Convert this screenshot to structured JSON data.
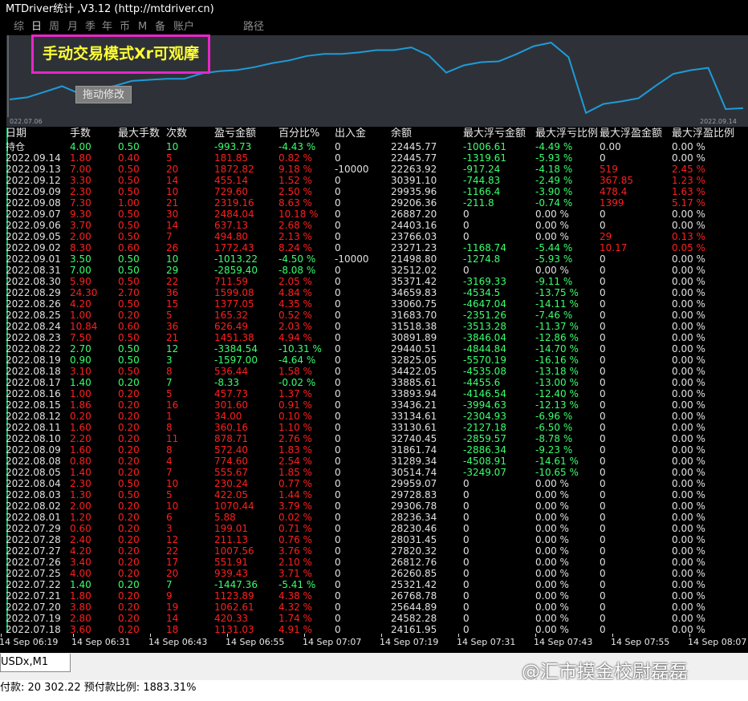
{
  "window": {
    "title": "MTDriver统计 ,V3.12 (http://mtdriver.cn)"
  },
  "tabs": [
    "综",
    "日",
    "周",
    "月",
    "季",
    "年",
    "币",
    "M",
    "备",
    "账户",
    "路径"
  ],
  "active_tab_index": 1,
  "chart": {
    "mode_label": "手动交易模式Xr可观摩",
    "drag_button": "拖动修改",
    "start_date": "022.07.06",
    "end_date": "2022.09.14",
    "line_color": "#1e9bd8",
    "balance_series": [
      24161.95,
      24582.28,
      25644.89,
      26768.78,
      25321.42,
      26260.85,
      26812.76,
      27820.32,
      28031.45,
      28230.46,
      28236.34,
      29306.78,
      29728.83,
      29959.07,
      30514.74,
      31289.34,
      31861.74,
      32740.45,
      33130.61,
      33134.61,
      33436.21,
      33893.94,
      33885.61,
      34422.05,
      32825.05,
      29440.51,
      30891.89,
      31518.38,
      31683.7,
      33060.75,
      34659.83,
      35371.42,
      32512.02,
      21498.8,
      23271.23,
      23766.03,
      24403.16,
      26887.2,
      29206.36,
      29935.96,
      30391.1,
      22263.92,
      22445.77
    ]
  },
  "table": {
    "headers": [
      "日期",
      "手数",
      "最大手数",
      "次数",
      "盈亏金额",
      "百分比%",
      "出入金",
      "余额",
      "最大浮亏金额",
      "最大浮亏比例",
      "最大浮盈金额",
      "最大浮盈比例"
    ],
    "rows": [
      [
        "持仓",
        "4.00",
        "0.50",
        "10",
        "-993.73",
        "-4.43 %",
        "0",
        "22445.77",
        "-1006.61",
        "-4.49 %",
        "0.00",
        "0.00 %"
      ],
      [
        "2022.09.14",
        "1.80",
        "0.40",
        "5",
        "181.85",
        "0.82 %",
        "0",
        "22445.77",
        "-1319.61",
        "-5.93 %",
        "0",
        "0.00 %"
      ],
      [
        "2022.09.13",
        "7.00",
        "0.50",
        "20",
        "1872.82",
        "9.18 %",
        "-10000",
        "22263.92",
        "-917.24",
        "-4.18 %",
        "519",
        "2.45 %"
      ],
      [
        "2022.09.12",
        "3.30",
        "0.50",
        "14",
        "455.14",
        "1.52 %",
        "0",
        "30391.10",
        "-744.83",
        "-2.49 %",
        "367.85",
        "1.23 %"
      ],
      [
        "2022.09.09",
        "2.30",
        "0.50",
        "10",
        "729.60",
        "2.50 %",
        "0",
        "29935.96",
        "-1166.4",
        "-3.90 %",
        "478.4",
        "1.63 %"
      ],
      [
        "2022.09.08",
        "7.30",
        "1.00",
        "21",
        "2319.16",
        "8.63 %",
        "0",
        "29206.36",
        "-211.8",
        "-0.74 %",
        "1399",
        "5.17 %"
      ],
      [
        "2022.09.07",
        "9.30",
        "0.50",
        "30",
        "2484.04",
        "10.18 %",
        "0",
        "26887.20",
        "0",
        "0.00 %",
        "0",
        "0.00 %"
      ],
      [
        "2022.09.06",
        "3.70",
        "0.50",
        "14",
        "637.13",
        "2.68 %",
        "0",
        "24403.16",
        "0",
        "0.00 %",
        "0",
        "0.00 %"
      ],
      [
        "2022.09.05",
        "2.00",
        "0.50",
        "7",
        "494.80",
        "2.13 %",
        "0",
        "23766.03",
        "0",
        "0.00 %",
        "29",
        "0.13 %"
      ],
      [
        "2022.09.02",
        "8.30",
        "0.60",
        "26",
        "1772.43",
        "8.24 %",
        "0",
        "23271.23",
        "-1168.74",
        "-5.44 %",
        "10.17",
        "0.05 %"
      ],
      [
        "2022.09.01",
        "3.50",
        "0.50",
        "10",
        "-1013.22",
        "-4.50 %",
        "-10000",
        "21498.80",
        "-1274.8",
        "-5.93 %",
        "0",
        "0.00 %"
      ],
      [
        "2022.08.31",
        "7.00",
        "0.50",
        "29",
        "-2859.40",
        "-8.08 %",
        "0",
        "32512.02",
        "0",
        "0.00 %",
        "0",
        "0.00 %"
      ],
      [
        "2022.08.30",
        "5.90",
        "0.50",
        "22",
        "711.59",
        "2.05 %",
        "0",
        "35371.42",
        "-3169.33",
        "-9.11 %",
        "0",
        "0.00 %"
      ],
      [
        "2022.08.29",
        "24.30",
        "2.70",
        "36",
        "1599.08",
        "4.84 %",
        "0",
        "34659.83",
        "-4534.5",
        "-13.75 %",
        "0",
        "0.00 %"
      ],
      [
        "2022.08.26",
        "4.20",
        "0.50",
        "15",
        "1377.05",
        "4.35 %",
        "0",
        "33060.75",
        "-4647.04",
        "-14.11 %",
        "0",
        "0.00 %"
      ],
      [
        "2022.08.25",
        "1.00",
        "0.20",
        "5",
        "165.32",
        "0.52 %",
        "0",
        "31683.70",
        "-2351.26",
        "-7.46 %",
        "0",
        "0.00 %"
      ],
      [
        "2022.08.24",
        "10.84",
        "0.60",
        "36",
        "626.49",
        "2.03 %",
        "0",
        "31518.38",
        "-3513.28",
        "-11.37 %",
        "0",
        "0.00 %"
      ],
      [
        "2022.08.23",
        "7.50",
        "0.50",
        "21",
        "1451.38",
        "4.94 %",
        "0",
        "30891.89",
        "-3846.04",
        "-12.86 %",
        "0",
        "0.00 %"
      ],
      [
        "2022.08.22",
        "2.70",
        "0.50",
        "12",
        "-3384.54",
        "-10.31 %",
        "0",
        "29440.51",
        "-4844.84",
        "-14.70 %",
        "0",
        "0.00 %"
      ],
      [
        "2022.08.19",
        "0.90",
        "0.50",
        "3",
        "-1597.00",
        "-4.64 %",
        "0",
        "32825.05",
        "-5570.19",
        "-16.16 %",
        "0",
        "0.00 %"
      ],
      [
        "2022.08.18",
        "3.10",
        "0.50",
        "8",
        "536.44",
        "1.58 %",
        "0",
        "34422.05",
        "-4535.08",
        "-13.18 %",
        "0",
        "0.00 %"
      ],
      [
        "2022.08.17",
        "1.40",
        "0.20",
        "7",
        "-8.33",
        "-0.02 %",
        "0",
        "33885.61",
        "-4455.6",
        "-13.00 %",
        "0",
        "0.00 %"
      ],
      [
        "2022.08.16",
        "1.00",
        "0.20",
        "5",
        "457.73",
        "1.37 %",
        "0",
        "33893.94",
        "-4146.54",
        "-12.40 %",
        "0",
        "0.00 %"
      ],
      [
        "2022.08.15",
        "1.86",
        "0.20",
        "16",
        "301.60",
        "0.91 %",
        "0",
        "33436.21",
        "-3994.63",
        "-12.13 %",
        "0",
        "0.00 %"
      ],
      [
        "2022.08.12",
        "0.20",
        "0.20",
        "1",
        "34.00",
        "0.10 %",
        "0",
        "33134.61",
        "-2304.93",
        "-6.96 %",
        "0",
        "0.00 %"
      ],
      [
        "2022.08.11",
        "1.60",
        "0.20",
        "8",
        "360.16",
        "1.10 %",
        "0",
        "33130.61",
        "-2127.18",
        "-6.50 %",
        "0",
        "0.00 %"
      ],
      [
        "2022.08.10",
        "2.20",
        "0.20",
        "11",
        "878.71",
        "2.76 %",
        "0",
        "32740.45",
        "-2859.57",
        "-8.78 %",
        "0",
        "0.00 %"
      ],
      [
        "2022.08.09",
        "1.60",
        "0.20",
        "8",
        "572.40",
        "1.83 %",
        "0",
        "31861.74",
        "-2886.34",
        "-9.23 %",
        "0",
        "0.00 %"
      ],
      [
        "2022.08.08",
        "0.80",
        "0.20",
        "4",
        "774.60",
        "2.54 %",
        "0",
        "31289.34",
        "-4508.91",
        "-14.61 %",
        "0",
        "0.00 %"
      ],
      [
        "2022.08.05",
        "1.40",
        "0.20",
        "7",
        "555.67",
        "1.85 %",
        "0",
        "30514.74",
        "-3249.07",
        "-10.65 %",
        "0",
        "0.00 %"
      ],
      [
        "2022.08.04",
        "2.30",
        "0.50",
        "10",
        "230.24",
        "0.77 %",
        "0",
        "29959.07",
        "0",
        "0.00 %",
        "0",
        "0.00 %"
      ],
      [
        "2022.08.03",
        "1.30",
        "0.50",
        "5",
        "422.05",
        "1.44 %",
        "0",
        "29728.83",
        "0",
        "0.00 %",
        "0",
        "0.00 %"
      ],
      [
        "2022.08.02",
        "2.00",
        "0.20",
        "10",
        "1070.44",
        "3.79 %",
        "0",
        "29306.78",
        "0",
        "0.00 %",
        "0",
        "0.00 %"
      ],
      [
        "2022.08.01",
        "1.20",
        "0.20",
        "6",
        "5.88",
        "0.02 %",
        "0",
        "28236.34",
        "0",
        "0.00 %",
        "0",
        "0.00 %"
      ],
      [
        "2022.07.29",
        "0.60",
        "0.20",
        "3",
        "199.01",
        "0.71 %",
        "0",
        "28230.46",
        "0",
        "0.00 %",
        "0",
        "0.00 %"
      ],
      [
        "2022.07.28",
        "2.40",
        "0.20",
        "12",
        "211.13",
        "0.76 %",
        "0",
        "28031.45",
        "0",
        "0.00 %",
        "0",
        "0.00 %"
      ],
      [
        "2022.07.27",
        "4.20",
        "0.20",
        "22",
        "1007.56",
        "3.76 %",
        "0",
        "27820.32",
        "0",
        "0.00 %",
        "0",
        "0.00 %"
      ],
      [
        "2022.07.26",
        "3.40",
        "0.20",
        "17",
        "551.91",
        "2.10 %",
        "0",
        "26812.76",
        "0",
        "0.00 %",
        "0",
        "0.00 %"
      ],
      [
        "2022.07.25",
        "4.00",
        "0.20",
        "20",
        "939.43",
        "3.71 %",
        "0",
        "26260.85",
        "0",
        "0.00 %",
        "0",
        "0.00 %"
      ],
      [
        "2022.07.22",
        "1.40",
        "0.20",
        "7",
        "-1447.36",
        "-5.41 %",
        "0",
        "25321.42",
        "0",
        "0.00 %",
        "0",
        "0.00 %"
      ],
      [
        "2022.07.21",
        "1.80",
        "0.20",
        "9",
        "1123.89",
        "4.38 %",
        "0",
        "26768.78",
        "0",
        "0.00 %",
        "0",
        "0.00 %"
      ],
      [
        "2022.07.20",
        "3.80",
        "0.20",
        "19",
        "1062.61",
        "4.32 %",
        "0",
        "25644.89",
        "0",
        "0.00 %",
        "0",
        "0.00 %"
      ],
      [
        "2022.07.19",
        "2.80",
        "0.20",
        "14",
        "420.33",
        "1.74 %",
        "0",
        "24582.28",
        "0",
        "0.00 %",
        "0",
        "0.00 %"
      ],
      [
        "2022.07.18",
        "3.60",
        "0.20",
        "18",
        "1131.03",
        "4.91 %",
        "0",
        "24161.95",
        "0",
        "0.00 %",
        "0",
        "0.00 %"
      ]
    ]
  },
  "time_axis": [
    "14 Sep 06:19",
    "14 Sep 06:31",
    "14 Sep 06:43",
    "14 Sep 06:55",
    "14 Sep 07:07",
    "14 Sep 07:19",
    "14 Sep 07:31",
    "14 Sep 07:43",
    "14 Sep 07:55",
    "14 Sep 08:07"
  ],
  "symbol_tab": "USDx,M1",
  "watermark": "@汇市摸金校尉磊磊",
  "status": "付款: 20 302.22  预付款比例: 1883.31%"
}
